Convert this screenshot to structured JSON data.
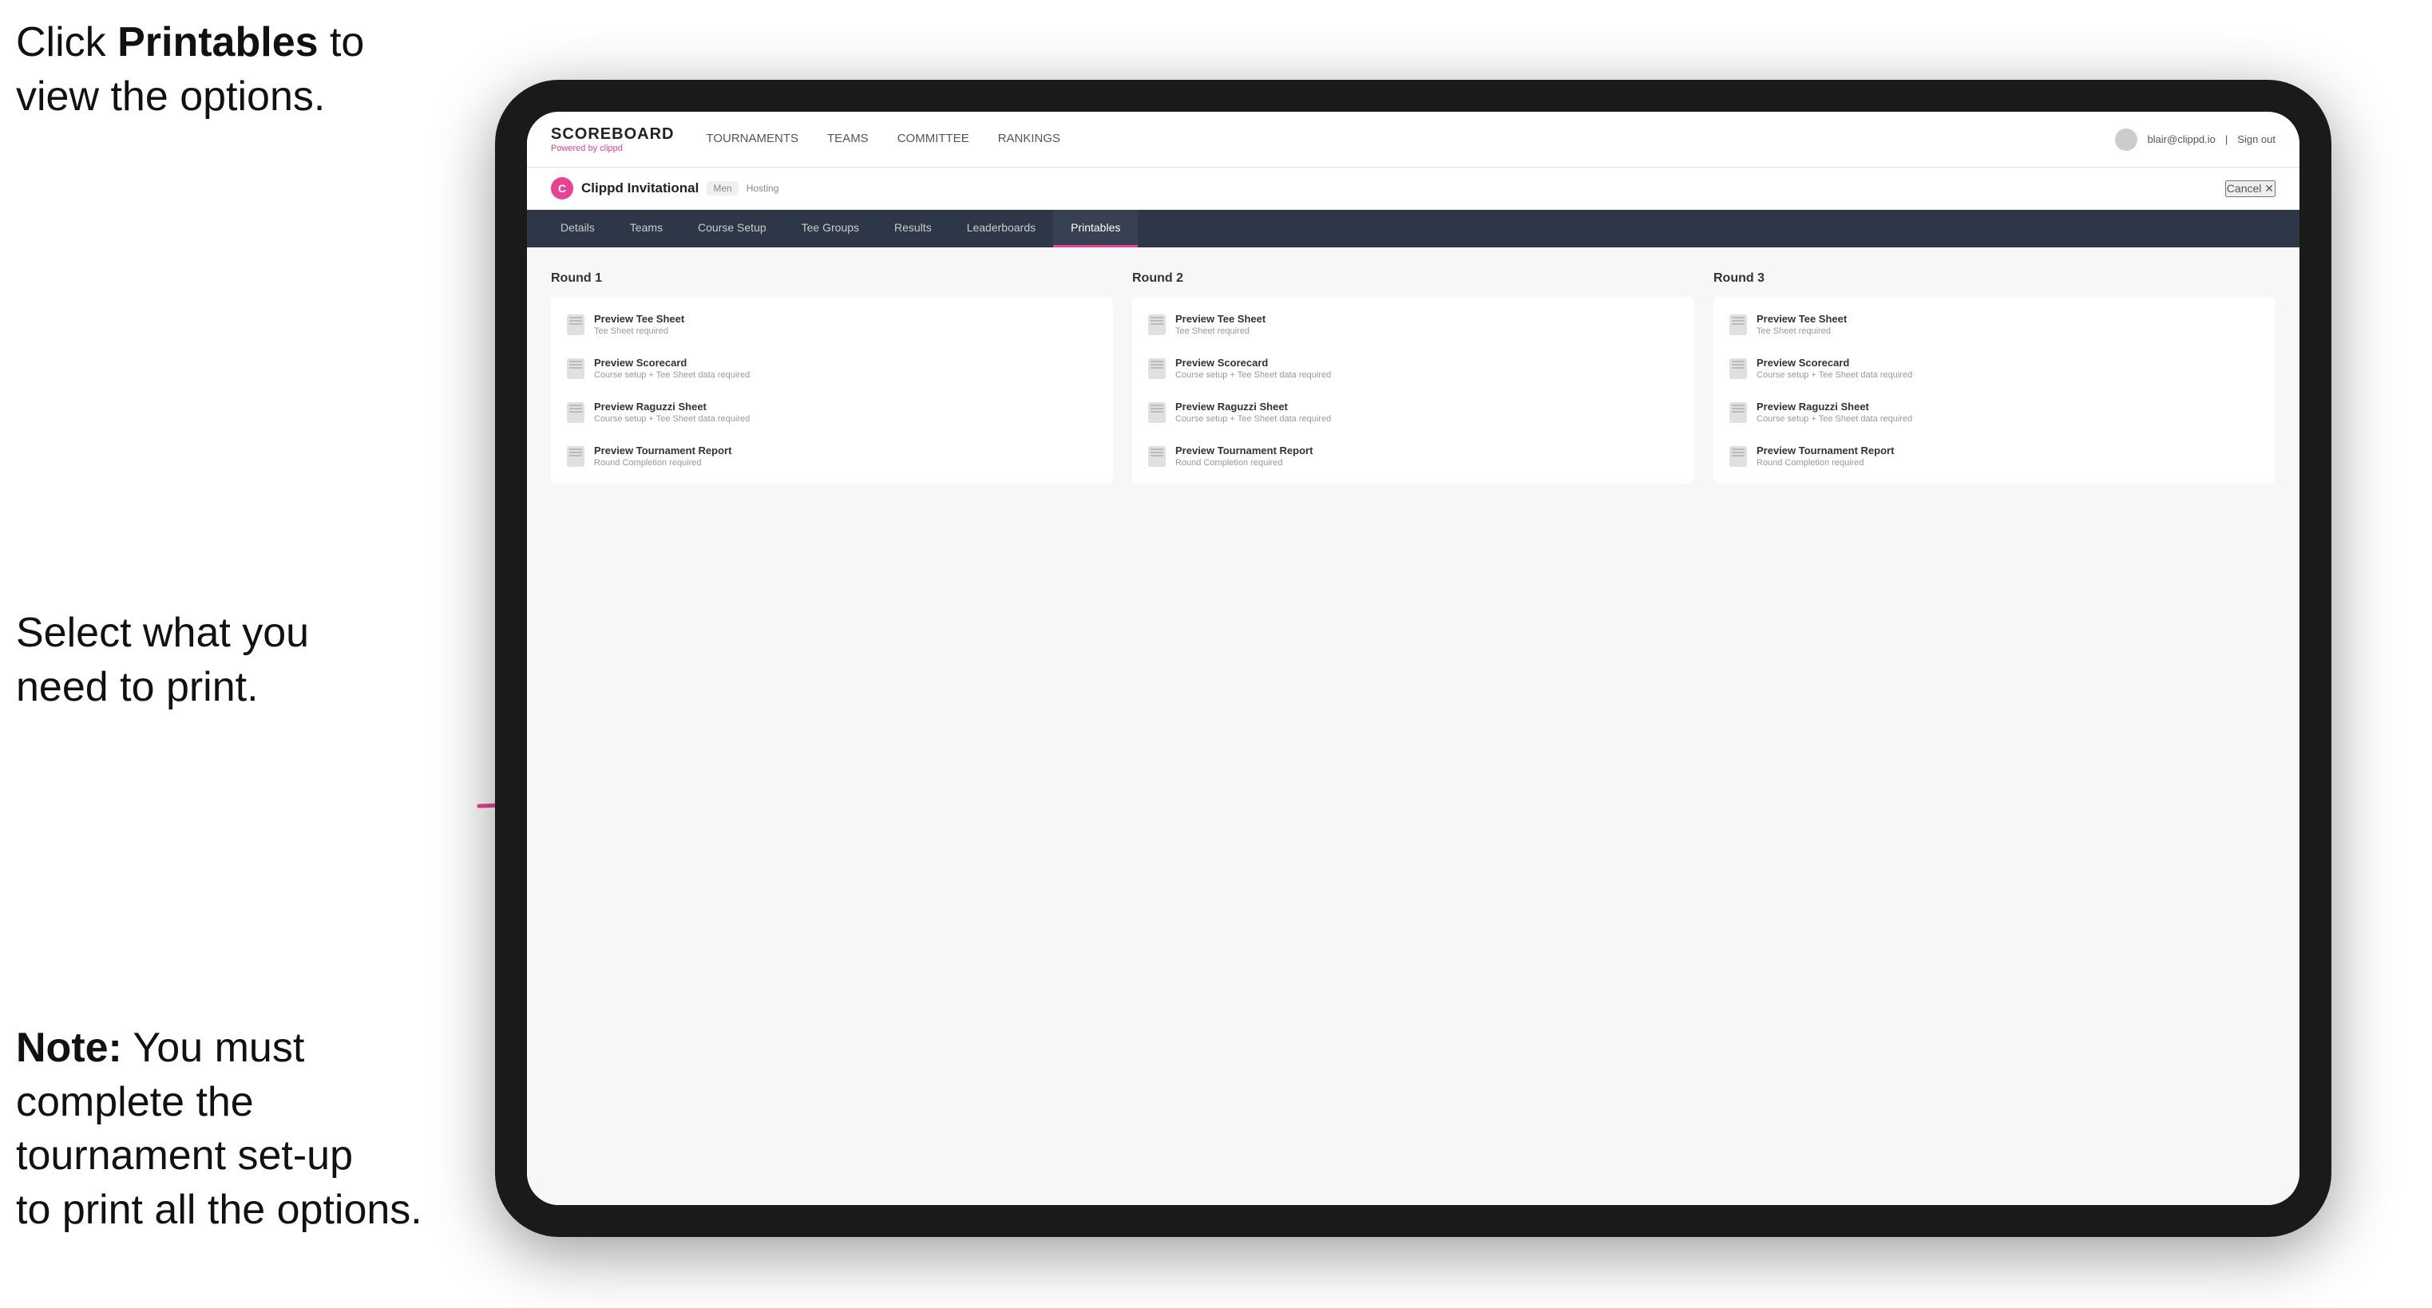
{
  "annotations": {
    "top_line1": "Click ",
    "top_bold": "Printables",
    "top_line2": " to",
    "top_line3": "view the options.",
    "middle": "Select what you\nneed to print.",
    "bottom_bold": "Note:",
    "bottom_text": " You must\ncomplete the\ntournament set-up\nto print all the options."
  },
  "nav": {
    "logo": "SCOREBOARD",
    "logo_sub": "Powered by clippd",
    "links": [
      "TOURNAMENTS",
      "TEAMS",
      "COMMITTEE",
      "RANKINGS"
    ],
    "user_email": "blair@clippd.io",
    "sign_out": "Sign out"
  },
  "tournament": {
    "icon": "C",
    "name": "Clippd Invitational",
    "badge": "Men",
    "hosting": "Hosting",
    "cancel": "Cancel ✕"
  },
  "sub_tabs": [
    "Details",
    "Teams",
    "Course Setup",
    "Tee Groups",
    "Results",
    "Leaderboards",
    "Printables"
  ],
  "active_tab": "Printables",
  "rounds": [
    {
      "title": "Round 1",
      "items": [
        {
          "title": "Preview Tee Sheet",
          "subtitle": "Tee Sheet required"
        },
        {
          "title": "Preview Scorecard",
          "subtitle": "Course setup + Tee Sheet data required"
        },
        {
          "title": "Preview Raguzzi Sheet",
          "subtitle": "Course setup + Tee Sheet data required"
        },
        {
          "title": "Preview Tournament Report",
          "subtitle": "Round Completion required"
        }
      ]
    },
    {
      "title": "Round 2",
      "items": [
        {
          "title": "Preview Tee Sheet",
          "subtitle": "Tee Sheet required"
        },
        {
          "title": "Preview Scorecard",
          "subtitle": "Course setup + Tee Sheet data required"
        },
        {
          "title": "Preview Raguzzi Sheet",
          "subtitle": "Course setup + Tee Sheet data required"
        },
        {
          "title": "Preview Tournament Report",
          "subtitle": "Round Completion required"
        }
      ]
    },
    {
      "title": "Round 3",
      "items": [
        {
          "title": "Preview Tee Sheet",
          "subtitle": "Tee Sheet required"
        },
        {
          "title": "Preview Scorecard",
          "subtitle": "Course setup + Tee Sheet data required"
        },
        {
          "title": "Preview Raguzzi Sheet",
          "subtitle": "Course setup + Tee Sheet data required"
        },
        {
          "title": "Preview Tournament Report",
          "subtitle": "Round Completion required"
        }
      ]
    }
  ]
}
